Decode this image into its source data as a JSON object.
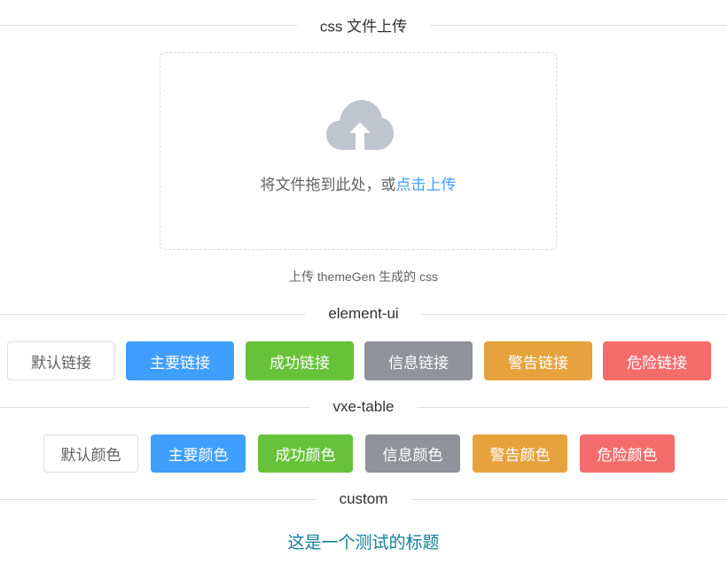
{
  "sections": {
    "css_upload": {
      "title": "css 文件上传"
    },
    "element_ui": {
      "title": "element-ui"
    },
    "vxe_table": {
      "title": "vxe-table"
    },
    "custom": {
      "title": "custom"
    }
  },
  "upload": {
    "drop_text": "将文件拖到此处，或",
    "link_text": "点击上传",
    "tip": "上传 themeGen 生成的 css",
    "icon": "cloud-upload-icon"
  },
  "element_buttons": [
    {
      "label": "默认链接",
      "type": "default"
    },
    {
      "label": "主要链接",
      "type": "primary",
      "color": "#409eff"
    },
    {
      "label": "成功链接",
      "type": "success",
      "color": "#67c23a"
    },
    {
      "label": "信息链接",
      "type": "info",
      "color": "#909399"
    },
    {
      "label": "警告链接",
      "type": "warning",
      "color": "#e6a23c"
    },
    {
      "label": "危险链接",
      "type": "danger",
      "color": "#f56c6c"
    }
  ],
  "vxe_buttons": [
    {
      "label": "默认颜色",
      "type": "default"
    },
    {
      "label": "主要颜色",
      "type": "primary",
      "color": "#409eff"
    },
    {
      "label": "成功颜色",
      "type": "success",
      "color": "#67c23a"
    },
    {
      "label": "信息颜色",
      "type": "info",
      "color": "#909399"
    },
    {
      "label": "警告颜色",
      "type": "warning",
      "color": "#e6a23c"
    },
    {
      "label": "危险颜色",
      "type": "danger",
      "color": "#f56c6c"
    }
  ],
  "custom": {
    "heading": "这是一个测试的标题",
    "color": "#117f96"
  }
}
